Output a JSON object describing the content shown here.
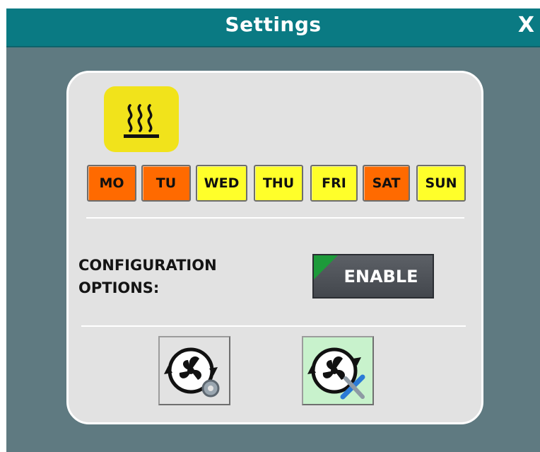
{
  "window": {
    "title": "Settings",
    "close_label": "X"
  },
  "heating": {
    "icon": "heat-icon",
    "color": "#f1e31b"
  },
  "days": [
    {
      "label": "MO",
      "color": "#ff6a00"
    },
    {
      "label": "TU",
      "color": "#ff6a00"
    },
    {
      "label": "WED",
      "color": "#ffff2a"
    },
    {
      "label": "THU",
      "color": "#ffff2a"
    },
    {
      "label": "FRI",
      "color": "#ffff2a"
    },
    {
      "label": "SAT",
      "color": "#ff6a00"
    },
    {
      "label": "SUN",
      "color": "#ffff2a"
    }
  ],
  "config": {
    "label_line1": "CONFIGURATION",
    "label_line2": "OPTIONS:",
    "enable_label": "ENABLE"
  },
  "fan_buttons": [
    {
      "icon": "fan-settings-icon",
      "background": "#e2e2e2"
    },
    {
      "icon": "fan-tools-icon",
      "background": "#c8f2cc"
    }
  ]
}
